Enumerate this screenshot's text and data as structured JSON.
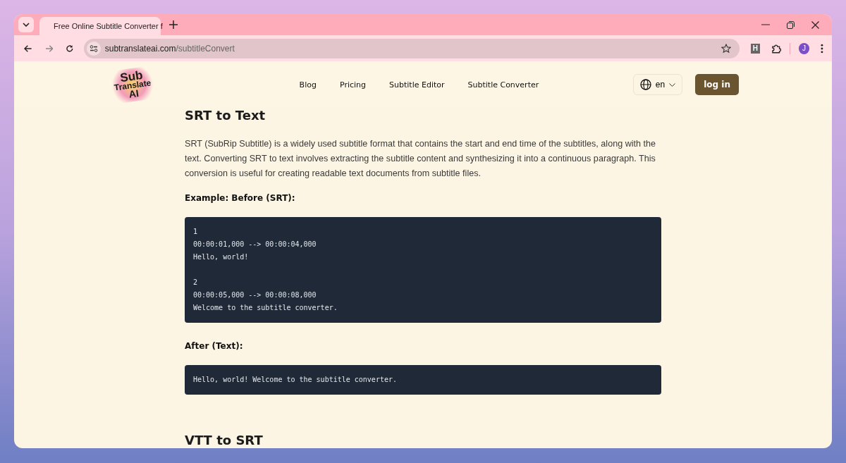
{
  "browser": {
    "tab_title": "Free Online Subtitle Converter f",
    "url_domain": "subtranslateai.com",
    "url_path": "/subtitleConvert",
    "profile_initial": "J",
    "extension_label": "H"
  },
  "header": {
    "logo": [
      "Sub",
      "Translate",
      "AI"
    ],
    "nav": [
      "Blog",
      "Pricing",
      "Subtitle Editor",
      "Subtitle Converter"
    ],
    "language": "en",
    "login": "log in"
  },
  "article": [
    {
      "kind": "heading",
      "text": "SRT to Text"
    },
    {
      "kind": "paragraph",
      "text": "SRT (SubRip Subtitle) is a widely used subtitle format that contains the start and end time of the subtitles, along with the text. Converting SRT to text involves extracting the subtitle content and synthesizing it into a continuous paragraph. This conversion is useful for creating readable text documents from subtitle files."
    },
    {
      "kind": "label",
      "text": "Example: Before (SRT):"
    },
    {
      "kind": "code",
      "groups": [
        [
          "1",
          "00:00:01,000 --> 00:00:04,000",
          "Hello, world!"
        ],
        [
          "2",
          "00:00:05,000 --> 00:00:08,000",
          "Welcome to the subtitle converter."
        ]
      ]
    },
    {
      "kind": "label",
      "text": "After (Text):"
    },
    {
      "kind": "code",
      "groups": [
        [
          "Hello, world! Welcome to the subtitle converter."
        ]
      ]
    },
    {
      "kind": "heading",
      "text": "VTT to SRT"
    }
  ]
}
